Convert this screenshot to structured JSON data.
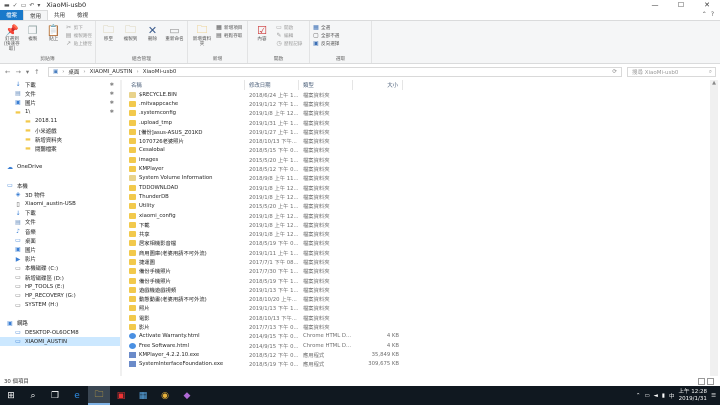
{
  "window": {
    "title": "XiaoMi-usb0"
  },
  "window_buttons": {
    "minimize": "—",
    "maximize": "☐",
    "close": "✕"
  },
  "ribbon_tabs": {
    "file": "檔案",
    "home": "常用",
    "share": "共用",
    "view": "檢視"
  },
  "ribbon": {
    "clipboard": {
      "pin": "釘選到[快速存取]",
      "copy": "複製",
      "paste": "貼上",
      "cut": "剪下",
      "copy_path": "複製路徑",
      "paste_shortcut": "貼上捷徑",
      "label": "剪貼簿"
    },
    "organize": {
      "move_to": "移至",
      "copy_to": "複製到",
      "delete": "刪除",
      "rename": "重新命名",
      "label": "組合管理"
    },
    "new": {
      "new_folder": "新增資料夾",
      "new_item": "新增項目",
      "easy_access": "輕鬆存取",
      "label": "新增"
    },
    "open": {
      "properties": "內容",
      "open": "開啟",
      "edit": "編輯",
      "history": "歷程記錄",
      "label": "開啟"
    },
    "select": {
      "select_all": "全選",
      "select_none": "全部不選",
      "invert": "反向選擇",
      "label": "選取"
    }
  },
  "address": {
    "root": "桌面",
    "segments": [
      "XIAOMI_AUSTIN",
      "XiaoMi-usb0"
    ]
  },
  "search": {
    "placeholder": "搜尋 XiaoMi-usb0"
  },
  "nav_pane": [
    {
      "label": "下載",
      "icon": "download-icon",
      "pinned": true
    },
    {
      "label": "文件",
      "icon": "document-icon",
      "pinned": true
    },
    {
      "label": "圖片",
      "icon": "pictures-icon",
      "pinned": true
    },
    {
      "label": "1\\",
      "icon": "folder-icon",
      "pinned": true
    },
    {
      "label": "2018.11",
      "icon": "folder-icon",
      "pinned": false
    },
    {
      "label": "小米遊戲",
      "icon": "folder-icon",
      "pinned": false
    },
    {
      "label": "新增資料夾",
      "icon": "folder-icon",
      "pinned": false
    },
    {
      "label": "閱聽檔案",
      "icon": "folder-icon",
      "pinned": false
    },
    {
      "label": "",
      "icon": "",
      "pinned": false
    },
    {
      "label": "OneDrive",
      "icon": "onedrive-icon",
      "pinned": false
    },
    {
      "label": "",
      "icon": "",
      "pinned": false
    },
    {
      "label": "本機",
      "icon": "pc-icon",
      "pinned": false
    },
    {
      "label": "3D 物件",
      "icon": "3d-icon",
      "pinned": false
    },
    {
      "label": "Xiaomi_austin-USB",
      "icon": "phone-icon",
      "pinned": false
    },
    {
      "label": "下載",
      "icon": "download-icon",
      "pinned": false
    },
    {
      "label": "文件",
      "icon": "document-icon",
      "pinned": false
    },
    {
      "label": "音樂",
      "icon": "music-icon",
      "pinned": false
    },
    {
      "label": "桌面",
      "icon": "desktop-icon",
      "pinned": false
    },
    {
      "label": "圖片",
      "icon": "pictures-icon",
      "pinned": false
    },
    {
      "label": "影片",
      "icon": "video-icon",
      "pinned": false
    },
    {
      "label": "本機磁碟 (C:)",
      "icon": "drive-icon",
      "pinned": false
    },
    {
      "label": "新增磁碟區 (D:)",
      "icon": "drive-icon",
      "pinned": false
    },
    {
      "label": "HP_TOOLS (E:)",
      "icon": "drive-icon",
      "pinned": false
    },
    {
      "label": "HP_RECOVERY (G:)",
      "icon": "drive-icon",
      "pinned": false
    },
    {
      "label": "SYSTEM (H:)",
      "icon": "drive-icon",
      "pinned": false
    },
    {
      "label": "",
      "icon": "",
      "pinned": false
    },
    {
      "label": "網路",
      "icon": "network-icon",
      "pinned": false
    },
    {
      "label": "DESKTOP-OL6OCM8",
      "icon": "computer-icon",
      "pinned": false
    },
    {
      "label": "XIAOMI_AUSTIN",
      "icon": "computer-icon",
      "pinned": false,
      "selected": true
    }
  ],
  "columns": {
    "name": "名稱",
    "date": "修改日期",
    "type": "類型",
    "size": "大小"
  },
  "files": [
    {
      "name": "$RECYCLE.BIN",
      "date": "2018/6/24 上午 1...",
      "type": "檔案資料夾",
      "size": "",
      "kind": "sysfolder"
    },
    {
      "name": ".mitvappcache",
      "date": "2019/1/12 下午 1...",
      "type": "檔案資料夾",
      "size": "",
      "kind": "folder"
    },
    {
      "name": ".systemconfig",
      "date": "2019/1/8 上午 12...",
      "type": "檔案資料夾",
      "size": "",
      "kind": "folder"
    },
    {
      "name": ".upload_tmp",
      "date": "2019/1/31 上午 1...",
      "type": "檔案資料夾",
      "size": "",
      "kind": "folder"
    },
    {
      "name": "[備份]asus-ASUS_Z01KD",
      "date": "2019/1/27 上午 1...",
      "type": "檔案資料夾",
      "size": "",
      "kind": "folder"
    },
    {
      "name": "1070726老婆照片",
      "date": "2018/10/13 下午...",
      "type": "檔案資料夾",
      "size": "",
      "kind": "folder"
    },
    {
      "name": "Cesalobal",
      "date": "2018/5/15 下午 0...",
      "type": "檔案資料夾",
      "size": "",
      "kind": "folder"
    },
    {
      "name": "images",
      "date": "2015/5/20 上午 1...",
      "type": "檔案資料夾",
      "size": "",
      "kind": "folder"
    },
    {
      "name": "KMPlayer",
      "date": "2018/5/12 下午 0...",
      "type": "檔案資料夾",
      "size": "",
      "kind": "folder"
    },
    {
      "name": "System Volume Information",
      "date": "2018/9/8 上午 11...",
      "type": "檔案資料夾",
      "size": "",
      "kind": "sysfolder"
    },
    {
      "name": "TDDOWNLOAD",
      "date": "2019/1/8 上午 12...",
      "type": "檔案資料夾",
      "size": "",
      "kind": "folder"
    },
    {
      "name": "ThunderDB",
      "date": "2019/1/8 上午 12...",
      "type": "檔案資料夾",
      "size": "",
      "kind": "folder"
    },
    {
      "name": "Utility",
      "date": "2015/5/20 上午 1...",
      "type": "檔案資料夾",
      "size": "",
      "kind": "folder"
    },
    {
      "name": "xiaomi_config",
      "date": "2019/1/8 上午 12...",
      "type": "檔案資料夾",
      "size": "",
      "kind": "folder"
    },
    {
      "name": "下載",
      "date": "2019/1/8 上午 12...",
      "type": "檔案資料夾",
      "size": "",
      "kind": "folder"
    },
    {
      "name": "共享",
      "date": "2019/1/8 上午 12...",
      "type": "檔案資料夾",
      "size": "",
      "kind": "folder"
    },
    {
      "name": "居家相機影音檔",
      "date": "2018/5/19 下午 0...",
      "type": "檔案資料夾",
      "size": "",
      "kind": "folder"
    },
    {
      "name": "商用圖庫(老婆用請不可外流)",
      "date": "2019/1/11 上午 1...",
      "type": "檔案資料夾",
      "size": "",
      "kind": "folder"
    },
    {
      "name": "捷運圖",
      "date": "2017/7/1 下午 08...",
      "type": "檔案資料夾",
      "size": "",
      "kind": "folder"
    },
    {
      "name": "備份手機照片",
      "date": "2017/7/30 下午 1...",
      "type": "檔案資料夾",
      "size": "",
      "kind": "folder"
    },
    {
      "name": "備份手機照片",
      "date": "2018/5/19 下午 1...",
      "type": "檔案資料夾",
      "size": "",
      "kind": "folder"
    },
    {
      "name": "遊戲機遊戲視頻",
      "date": "2019/1/13 下午 1...",
      "type": "檔案資料夾",
      "size": "",
      "kind": "folder"
    },
    {
      "name": "動態動畫(老婆用請不可外流)",
      "date": "2018/10/20 上午...",
      "type": "檔案資料夾",
      "size": "",
      "kind": "folder"
    },
    {
      "name": "照片",
      "date": "2019/1/13 下午 1...",
      "type": "檔案資料夾",
      "size": "",
      "kind": "folder"
    },
    {
      "name": "電影",
      "date": "2018/10/13 下午...",
      "type": "檔案資料夾",
      "size": "",
      "kind": "folder"
    },
    {
      "name": "影片",
      "date": "2017/7/13 下午 0...",
      "type": "檔案資料夾",
      "size": "",
      "kind": "folder"
    },
    {
      "name": "Activate Warranty.html",
      "date": "2014/9/15 下午 0...",
      "type": "Chrome HTML D...",
      "size": "4 KB",
      "kind": "html"
    },
    {
      "name": "Free Software.html",
      "date": "2014/9/15 下午 0...",
      "type": "Chrome HTML D...",
      "size": "4 KB",
      "kind": "html"
    },
    {
      "name": "KMPlayer_4.2.2.10.exe",
      "date": "2018/5/12 下午 0...",
      "type": "應用程式",
      "size": "35,849 KB",
      "kind": "exe"
    },
    {
      "name": "SystemInterfaceFoundation.exe",
      "date": "2018/5/19 下午 0...",
      "type": "應用程式",
      "size": "309,675 KB",
      "kind": "exe"
    }
  ],
  "status": {
    "count": "30 個項目"
  },
  "taskbar": {
    "time": "上午 12:28",
    "date": "2019/1/31"
  }
}
